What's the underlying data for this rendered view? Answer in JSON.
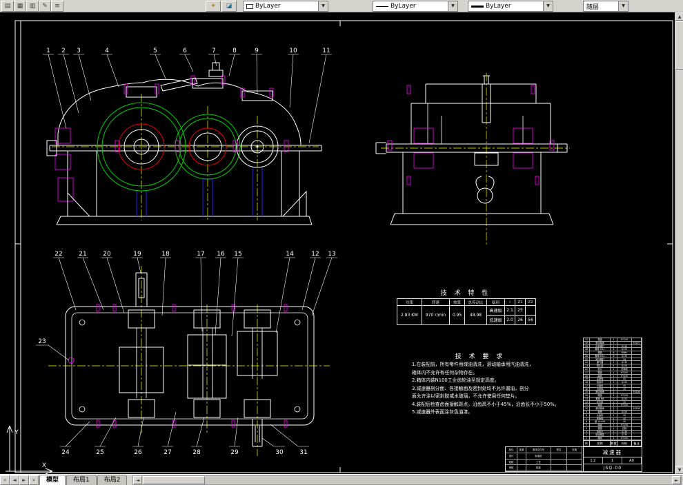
{
  "toolbar": {
    "buttons": [
      "list-icon",
      "table-icon",
      "grid-icon",
      "edit-icon",
      "layers-icon"
    ],
    "extra_buttons": [
      "make-block-icon",
      "design-center-icon"
    ],
    "dropdown_color": "ByLayer",
    "dropdown_linetype": "ByLayer",
    "dropdown_lineweight": "ByLayer",
    "dropdown_plotstyle": "随层",
    "dropdown_arrow": "▼"
  },
  "tabs": {
    "nav_first": "«",
    "nav_prev": "◄",
    "nav_next": "►",
    "nav_last": "»",
    "model": "模型",
    "layout1": "布局1",
    "layout2": "布局2",
    "hs_left": "◄",
    "hs_right": "►",
    "vs_up": "▲",
    "vs_down": "▼"
  },
  "ucs": {
    "x": "X",
    "y": "Y"
  },
  "callouts": {
    "top": [
      "1",
      "2",
      "3",
      "4",
      "5",
      "6",
      "7",
      "8",
      "9",
      "10",
      "11"
    ],
    "mid": [
      "22",
      "21",
      "20",
      "19",
      "18",
      "17",
      "16",
      "15",
      "14",
      "12",
      "13"
    ],
    "left": "23",
    "bottom": [
      "24",
      "25",
      "26",
      "27",
      "28",
      "29",
      "30",
      "31"
    ]
  },
  "tech_table": {
    "title": "技 术 特 性",
    "headers": [
      "功率",
      "转速",
      "效率",
      "总传动比",
      "级别",
      "i",
      "Z1",
      "Z2"
    ],
    "power": "2.83 KW",
    "speed": "970 r/min",
    "eff": "0.95",
    "ratio": "48.98",
    "row_high": {
      "label": "高速级",
      "i": "2.1",
      "z1": "25",
      "z2": ""
    },
    "row_low": {
      "label": "低速级",
      "i": "2.0",
      "z1": "26",
      "z2": "56"
    }
  },
  "tech_req": {
    "title": "技 术 要 求",
    "lines": [
      "1.在装配前，所有零件用煤油清洗，滚动轴承用汽油清洗，",
      "  箱体内不允许有任何杂物存在。",
      "2.箱体内装N100工业齿轮油至规定高度。",
      "3.减速器剖分面、各接触面及密封处均不允许漏油，剖分",
      "  面允许涂以密封胶或水玻璃，不允许使用任何垫片。",
      "4.装配后检查齿面接触斑点，沿齿高不小于45%，沿齿长不小于50%。",
      "5.减速器外表面涂灰色油漆。"
    ]
  },
  "bom": {
    "headers": [
      "序号",
      "名称",
      "数量",
      "材料",
      "备注"
    ],
    "rows": [
      [
        "31",
        "端盖",
        "1",
        "HT150",
        ""
      ],
      [
        "30",
        "滚动轴承",
        "2",
        "",
        "30207"
      ],
      [
        "29",
        "启盖螺钉",
        "1",
        "Q235",
        ""
      ],
      [
        "28",
        "螺栓 M12",
        "6",
        "Q235",
        ""
      ],
      [
        "27",
        "垫圈",
        "6",
        "65Mn",
        ""
      ],
      [
        "26",
        "螺母 M12",
        "6",
        "Q235",
        ""
      ],
      [
        "25",
        "吊环螺钉",
        "2",
        "20",
        ""
      ],
      [
        "24",
        "通气器",
        "1",
        "Q235",
        ""
      ],
      [
        "23",
        "视孔盖",
        "1",
        "Q235",
        ""
      ],
      [
        "22",
        "垫片",
        "1",
        "石棉纸",
        ""
      ],
      [
        "21",
        "箱盖",
        "1",
        "HT200",
        ""
      ],
      [
        "20",
        "端盖",
        "1",
        "HT150",
        ""
      ],
      [
        "19",
        "高速轴",
        "1",
        "45",
        ""
      ],
      [
        "18",
        "挡油环",
        "2",
        "Q235",
        ""
      ],
      [
        "17",
        "小齿轮",
        "1",
        "45",
        ""
      ],
      [
        "16",
        "中间轴",
        "1",
        "45",
        ""
      ],
      [
        "15",
        "滚动轴承",
        "2",
        "",
        "30206"
      ],
      [
        "14",
        "端盖",
        "1",
        "HT150",
        ""
      ],
      [
        "13",
        "螺栓 M8",
        "2",
        "Q235",
        ""
      ],
      [
        "12",
        "定位销",
        "2",
        "35",
        ""
      ],
      [
        "11",
        "端盖",
        "1",
        "HT150",
        ""
      ],
      [
        "10",
        "滚动轴承",
        "2",
        "",
        "30208"
      ],
      [
        "9",
        "套筒",
        "1",
        "Q235",
        ""
      ],
      [
        "8",
        "大齿轮",
        "1",
        "45",
        ""
      ],
      [
        "7",
        "低速轴",
        "1",
        "45",
        ""
      ],
      [
        "6",
        "键 14×56",
        "1",
        "45",
        ""
      ],
      [
        "5",
        "端盖",
        "1",
        "HT150",
        ""
      ],
      [
        "4",
        "垫圈",
        "1",
        "石棉",
        ""
      ],
      [
        "3",
        "油标尺",
        "1",
        "Q235",
        ""
      ],
      [
        "2",
        "放油螺塞",
        "1",
        "Q235",
        ""
      ],
      [
        "1",
        "箱座",
        "1",
        "HT200",
        ""
      ]
    ]
  },
  "titleblock": {
    "name": "减速器",
    "scale": "1:2",
    "qty": "1",
    "sheet": "A0",
    "code": "JSQ-00",
    "left_rows": [
      [
        "标记",
        "处数",
        "更改文件号",
        "签名",
        "日期"
      ],
      [
        "设计",
        "",
        "标准化",
        "",
        ""
      ],
      [
        "校核",
        "",
        "工艺",
        "",
        ""
      ],
      [
        "审核",
        "",
        "批准",
        "",
        ""
      ]
    ]
  }
}
